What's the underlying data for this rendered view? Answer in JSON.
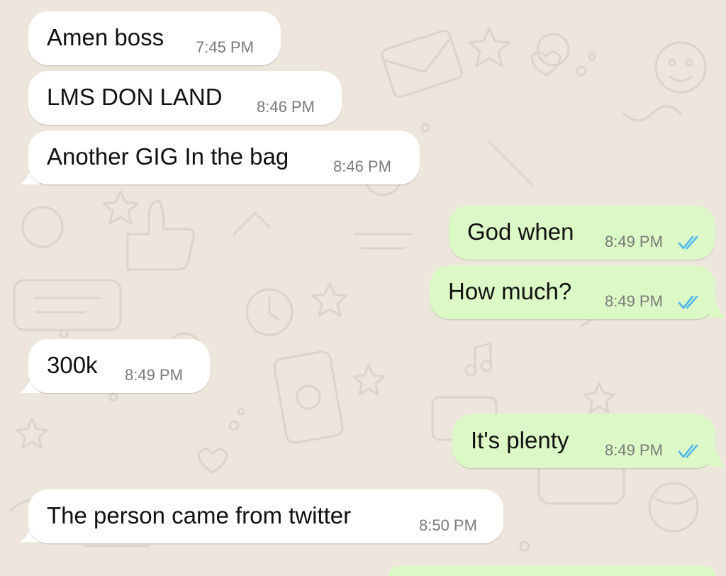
{
  "colors": {
    "incoming_bubble": "#ffffff",
    "outgoing_bubble": "#dcf8c6",
    "wallpaper": "#ede6dd",
    "read_ticks": "#4fb6ec",
    "timestamp": "#7b7b7b"
  },
  "messages": [
    {
      "direction": "incoming",
      "text": "Amen boss",
      "time": "7:45 PM"
    },
    {
      "direction": "incoming",
      "text": "LMS DON LAND",
      "time": "8:46 PM"
    },
    {
      "direction": "incoming",
      "text": "Another GIG In the bag",
      "time": "8:46 PM"
    },
    {
      "direction": "outgoing",
      "text": "God when",
      "time": "8:49 PM",
      "status_icon": "double-check-read-icon"
    },
    {
      "direction": "outgoing",
      "text": "How much?",
      "time": "8:49 PM",
      "status_icon": "double-check-read-icon"
    },
    {
      "direction": "incoming",
      "text": "300k",
      "time": "8:49 PM"
    },
    {
      "direction": "outgoing",
      "text": "It's plenty",
      "time": "8:49 PM",
      "status_icon": "double-check-read-icon"
    },
    {
      "direction": "incoming",
      "text": "The person came from twitter",
      "time": "8:50 PM"
    }
  ]
}
